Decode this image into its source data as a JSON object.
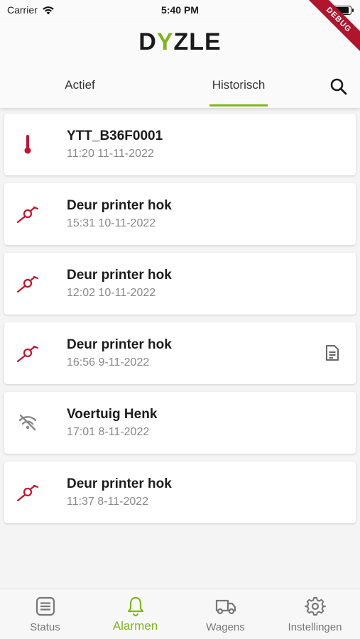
{
  "status_bar": {
    "carrier": "Carrier",
    "time": "5:40 PM"
  },
  "debug_label": "DEBUG",
  "header": {
    "logo_parts": [
      "D",
      "Y",
      "ZLE"
    ],
    "tabs": [
      {
        "label": "Actief"
      },
      {
        "label": "Historisch"
      }
    ],
    "active_tab": "Historisch"
  },
  "alarms": [
    {
      "title": "YTT_B36F0001",
      "datetime": "11:20 11-11-2022",
      "icon": "thermometer-icon"
    },
    {
      "title": "Deur printer hok",
      "datetime": "15:31 10-11-2022",
      "icon": "door-sensor-icon"
    },
    {
      "title": "Deur printer hok",
      "datetime": "12:02 10-11-2022",
      "icon": "door-sensor-icon"
    },
    {
      "title": "Deur printer hok",
      "datetime": "16:56 9-11-2022",
      "icon": "door-sensor-icon",
      "has_note": true
    },
    {
      "title": "Voertuig Henk",
      "datetime": "17:01 8-11-2022",
      "icon": "wifi-off-icon"
    },
    {
      "title": "Deur printer hok",
      "datetime": "11:37 8-11-2022",
      "icon": "door-sensor-icon"
    }
  ],
  "bottom_nav": [
    {
      "label": "Status",
      "icon": "list-icon"
    },
    {
      "label": "Alarmen",
      "icon": "bell-icon"
    },
    {
      "label": "Wagens",
      "icon": "truck-icon"
    },
    {
      "label": "Instellingen",
      "icon": "gear-icon"
    }
  ],
  "active_nav": "Alarmen",
  "colors": {
    "accent": "#7fb51f",
    "alarm": "#c8102e",
    "text": "#1c1c1c",
    "muted": "#888888"
  }
}
